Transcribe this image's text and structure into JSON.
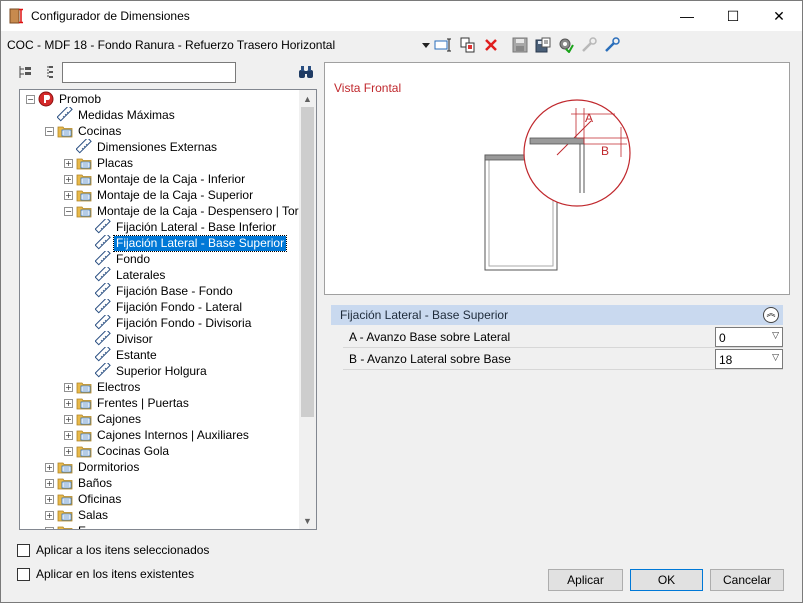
{
  "window": {
    "title": "Configurador de Dimensiones",
    "controls": {
      "minimize": "—",
      "maximize": "☐",
      "close": "✕"
    }
  },
  "modelbar": {
    "title": "COC - MDF 18 - Fondo Ranura - Refuerzo Trasero Horizontal",
    "icons": [
      "dropdown-arrow-icon",
      "rename-icon",
      "copy-icon",
      "delete-icon",
      "save-icon",
      "save-as-icon",
      "settings-icon",
      "tool-disabled-icon",
      "tool-icon"
    ]
  },
  "search": {
    "placeholder": "",
    "value": ""
  },
  "tree": {
    "items": [
      {
        "label": "Promob",
        "level": 0,
        "expander": "−",
        "icon": "promob-logo-icon"
      },
      {
        "label": "Medidas Máximas",
        "level": 1,
        "expander": "",
        "icon": "ruler-icon"
      },
      {
        "label": "Cocinas",
        "level": 1,
        "expander": "−",
        "icon": "folder-icon"
      },
      {
        "label": "Dimensiones Externas",
        "level": 2,
        "expander": "",
        "icon": "ruler-icon"
      },
      {
        "label": "Placas",
        "level": 2,
        "expander": "+",
        "icon": "folder-icon"
      },
      {
        "label": "Montaje de la Caja - Inferior",
        "level": 2,
        "expander": "+",
        "icon": "folder-icon"
      },
      {
        "label": "Montaje de la Caja - Superior",
        "level": 2,
        "expander": "+",
        "icon": "folder-icon"
      },
      {
        "label": "Montaje de la Caja - Despensero | Torres",
        "level": 2,
        "expander": "−",
        "icon": "folder-icon"
      },
      {
        "label": "Fijación Lateral - Base Inferior",
        "level": 3,
        "expander": "",
        "icon": "ruler-icon"
      },
      {
        "label": "Fijación Lateral - Base Superior",
        "level": 3,
        "expander": "",
        "icon": "ruler-icon",
        "selected": true
      },
      {
        "label": "Fondo",
        "level": 3,
        "expander": "",
        "icon": "ruler-icon"
      },
      {
        "label": "Laterales",
        "level": 3,
        "expander": "",
        "icon": "ruler-icon"
      },
      {
        "label": " Fijación Base - Fondo",
        "level": 3,
        "expander": "",
        "icon": "ruler-icon"
      },
      {
        "label": "Fijación Fondo - Lateral",
        "level": 3,
        "expander": "",
        "icon": "ruler-icon"
      },
      {
        "label": "Fijación Fondo - Divisoria",
        "level": 3,
        "expander": "",
        "icon": "ruler-icon"
      },
      {
        "label": "Divisor",
        "level": 3,
        "expander": "",
        "icon": "ruler-icon"
      },
      {
        "label": "Estante",
        "level": 3,
        "expander": "",
        "icon": "ruler-icon"
      },
      {
        "label": "Superior Holgura",
        "level": 3,
        "expander": "",
        "icon": "ruler-icon"
      },
      {
        "label": "Electros",
        "level": 2,
        "expander": "+",
        "icon": "folder-icon"
      },
      {
        "label": "Frentes | Puertas",
        "level": 2,
        "expander": "+",
        "icon": "folder-icon"
      },
      {
        "label": "Cajones",
        "level": 2,
        "expander": "+",
        "icon": "folder-icon"
      },
      {
        "label": "Cajones Internos | Auxiliares",
        "level": 2,
        "expander": "+",
        "icon": "folder-icon"
      },
      {
        "label": "Cocinas Gola",
        "level": 2,
        "expander": "+",
        "icon": "folder-icon"
      },
      {
        "label": "Dormitorios",
        "level": 1,
        "expander": "+",
        "icon": "folder-icon"
      },
      {
        "label": "Baños",
        "level": 1,
        "expander": "+",
        "icon": "folder-icon"
      },
      {
        "label": "Oficinas",
        "level": 1,
        "expander": "+",
        "icon": "folder-icon"
      },
      {
        "label": "Salas",
        "level": 1,
        "expander": "+",
        "icon": "folder-icon"
      },
      {
        "label": "E...",
        "level": 1,
        "expander": "+",
        "icon": "folder-icon"
      }
    ]
  },
  "preview": {
    "label": "Vista Frontal",
    "dim_a": "A",
    "dim_b": "B",
    "accent": "#c0282d"
  },
  "properties": {
    "title": "Fijación Lateral - Base Superior",
    "collapse_glyph": "︽",
    "rows": [
      {
        "label": "A - Avanzo Base sobre Lateral",
        "value": "0"
      },
      {
        "label": "B - Avanzo Lateral sobre Base",
        "value": "18"
      }
    ]
  },
  "options": {
    "apply_selected": "Aplicar a los itens seleccionados",
    "apply_existing": "Aplicar en los itens existentes"
  },
  "buttons": {
    "apply": "Aplicar",
    "ok": "OK",
    "cancel": "Cancelar"
  },
  "colors": {
    "selection": "#0078d7",
    "header": "#c9d9ef",
    "folder": "#e8b94a"
  }
}
